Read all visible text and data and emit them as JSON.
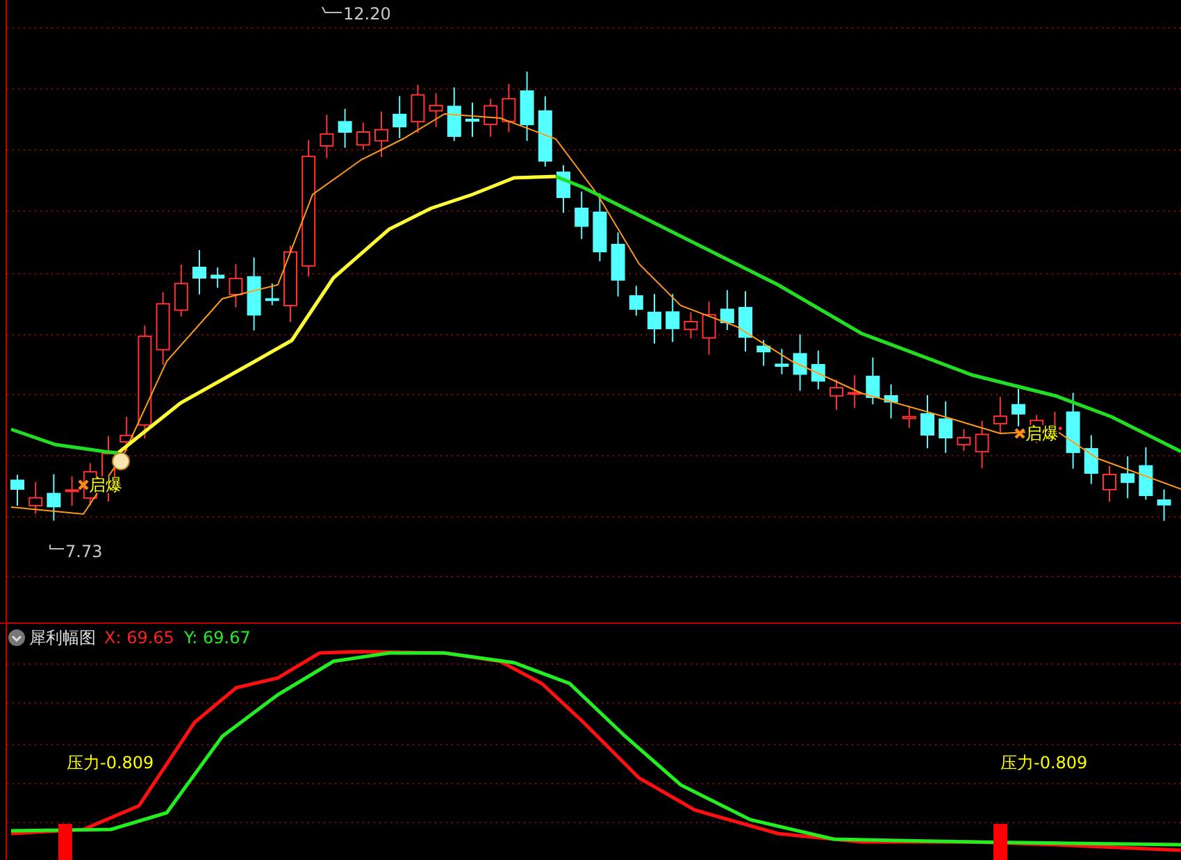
{
  "price_chart": {
    "high_label": "12.20",
    "low_label": "7.73",
    "signals": [
      {
        "label": "启爆"
      },
      {
        "label": "启爆"
      }
    ]
  },
  "indicator_panel": {
    "title": "犀利幅图",
    "x_reading": "X: 69.65",
    "y_reading": "Y: 69.67",
    "pressure_labels": [
      "压力-0.809",
      "压力-0.809"
    ]
  }
}
